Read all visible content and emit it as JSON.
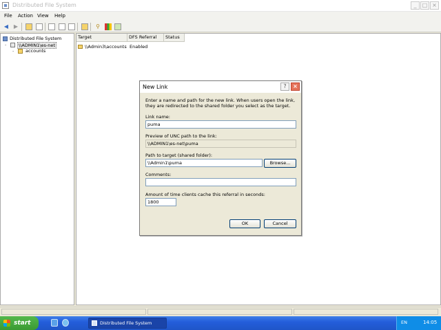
{
  "window": {
    "title": "Distributed File System",
    "controls": {
      "minimize": "_",
      "maximize": "□",
      "close": "×"
    }
  },
  "menubar": {
    "items": [
      {
        "label": "File",
        "key": "F"
      },
      {
        "label": "Action",
        "key": "A"
      },
      {
        "label": "View",
        "key": "V"
      },
      {
        "label": "Help",
        "key": "H"
      }
    ]
  },
  "toolbar": {
    "back_icon": "back-arrow-icon",
    "forward_icon": "forward-arrow-icon"
  },
  "tree": {
    "root": "Distributed File System",
    "root_expander": "-",
    "dfs_root": "\\\\ADMIN1\\es-net",
    "dfs_root_expander": "-",
    "link": "accounts"
  },
  "list": {
    "columns": [
      "Target",
      "DFS Referral",
      "Status"
    ],
    "rows": [
      {
        "target": "\\\\Admin3\\accounts",
        "referral": "Enabled",
        "status": ""
      }
    ]
  },
  "dialog": {
    "title": "New Link",
    "help_label": "?",
    "close_label": "×",
    "intro": "Enter a name and path for the new link. When users open the link, they are redirected to the shared folder you select as the target.",
    "link_name_label": "Link name:",
    "link_name_value": "puma",
    "unc_preview_label": "Preview of UNC path to the link:",
    "unc_preview_value": "\\\\ADMIN1\\es-net\\puma",
    "target_label": "Path to target (shared folder):",
    "target_value": "\\\\Admin1\\puma",
    "browse_label": "Browse...",
    "comments_label": "Comments:",
    "comments_value": "",
    "cache_label": "Amount of time clients cache this referral in seconds:",
    "cache_value": "1800",
    "ok_label": "OK",
    "cancel_label": "Cancel"
  },
  "taskbar": {
    "start_label": "start",
    "active_task": "Distributed File System",
    "language": "EN",
    "clock": "14:05"
  },
  "colors": {
    "accent": "#245edb",
    "start_green": "#3a9a32",
    "close_red": "#e5735a"
  }
}
